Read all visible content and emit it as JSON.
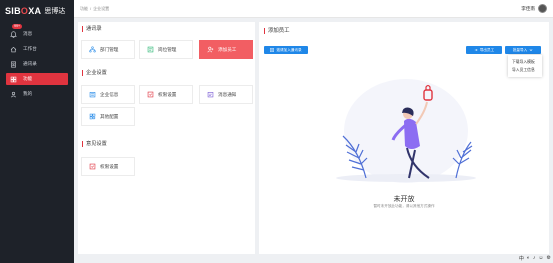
{
  "brand": {
    "en_a": "SIB",
    "en_o": "O",
    "en_b": "XA",
    "cn": "思博达"
  },
  "sidebar": {
    "items": [
      {
        "label": "消息",
        "icon": "bell-icon",
        "badge": "99+"
      },
      {
        "label": "工作台",
        "icon": "home-icon"
      },
      {
        "label": "通讯录",
        "icon": "contacts-icon"
      },
      {
        "label": "功能",
        "icon": "grid-icon",
        "active": true
      },
      {
        "label": "我的",
        "icon": "user-icon"
      }
    ]
  },
  "topbar": {
    "crumb": [
      "功能",
      "/",
      "企业设置"
    ],
    "user_name": "李佳南"
  },
  "left": {
    "sections": [
      {
        "title": "通讯录",
        "cards": [
          {
            "label": "部门管理",
            "icon": "org-icon"
          },
          {
            "label": "岗位管理",
            "icon": "position-icon"
          },
          {
            "label": "添加员工",
            "icon": "add-user-icon",
            "active": true
          }
        ]
      },
      {
        "title": "企业设置",
        "cards": [
          {
            "label": "企业信息",
            "icon": "company-info-icon"
          },
          {
            "label": "权限设置",
            "icon": "permission-icon"
          },
          {
            "label": "消息通知",
            "icon": "notify-icon"
          },
          {
            "label": "其他配置",
            "icon": "config-icon"
          }
        ]
      },
      {
        "title": "意见设置",
        "cards": [
          {
            "label": "权限设置",
            "icon": "permission-icon"
          }
        ]
      }
    ]
  },
  "main": {
    "title": "添加员工",
    "invite_button": "邀请加入通讯录",
    "export_button": "导出员工",
    "import_button": "批量导入",
    "dropdown": [
      "下载导入模板",
      "导入员工信息"
    ],
    "empty_title": "未开放",
    "empty_sub": "暂时未开放此功能，请以其他方式操作"
  },
  "colors": {
    "accent": "#e0343f",
    "primary": "#1f87e8",
    "sidebar": "#1e2229"
  },
  "tray": {
    "ime": "中"
  }
}
